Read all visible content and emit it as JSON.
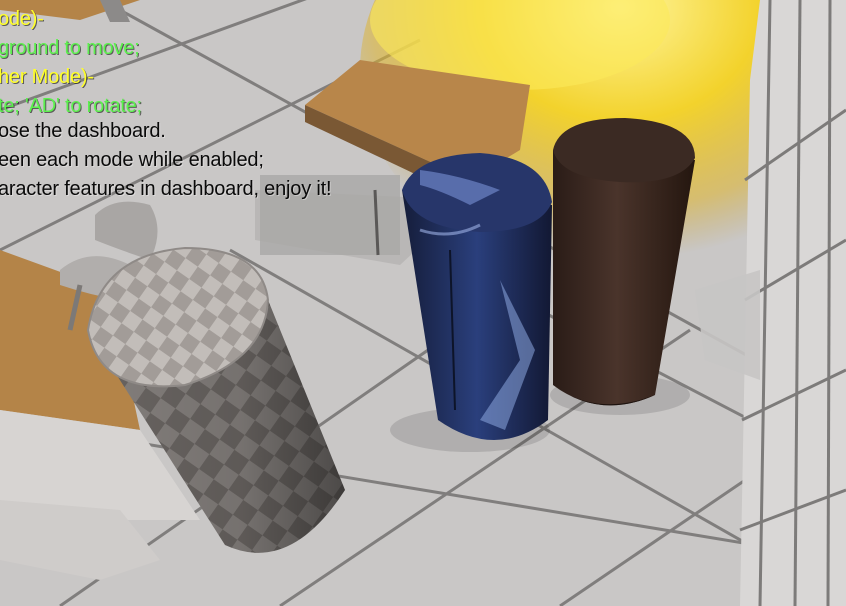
{
  "hud": {
    "lines": [
      {
        "text": "ode)-",
        "color": "yellow"
      },
      {
        "text": "ground to move;",
        "color": "green"
      },
      {
        "text": "her Mode)-",
        "color": "yellow"
      },
      {
        "text": "te; 'AD' to rotate;",
        "color": "green"
      },
      {
        "text": "ose the dashboard.",
        "color": "black"
      },
      {
        "text": "een each mode while enabled;",
        "color": "black"
      },
      {
        "text": "aracter features in dashboard, enjoy it!",
        "color": "black"
      }
    ]
  },
  "scene": {
    "objects": [
      "checker-cylinder",
      "blue-patterned-cylinder",
      "dark-brown-cylinder",
      "desk",
      "chair",
      "fire-effect",
      "lockers"
    ],
    "colors": {
      "floor": "#c9c7c6",
      "fire": "#f5d324",
      "desk_top": "#b8864a",
      "dark_cylinder": "#3a2a24",
      "blue_cylinder": "#1f2c55"
    }
  }
}
